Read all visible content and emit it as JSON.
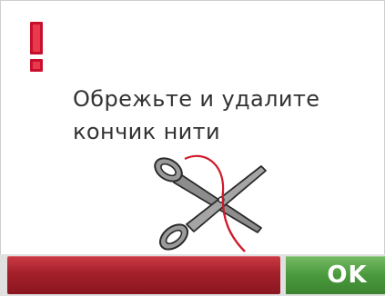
{
  "dialog": {
    "message": "Обрежьте и удалите кончик нити",
    "icon": "warning-exclamation-icon",
    "illustration": "scissors-cutting-thread-icon"
  },
  "buttons": {
    "ok_label": "OK"
  },
  "colors": {
    "warning": "#c8102e",
    "thread": "#d01a2a",
    "cancel_bar": "#a3202a",
    "ok": "#4a9a3d"
  }
}
